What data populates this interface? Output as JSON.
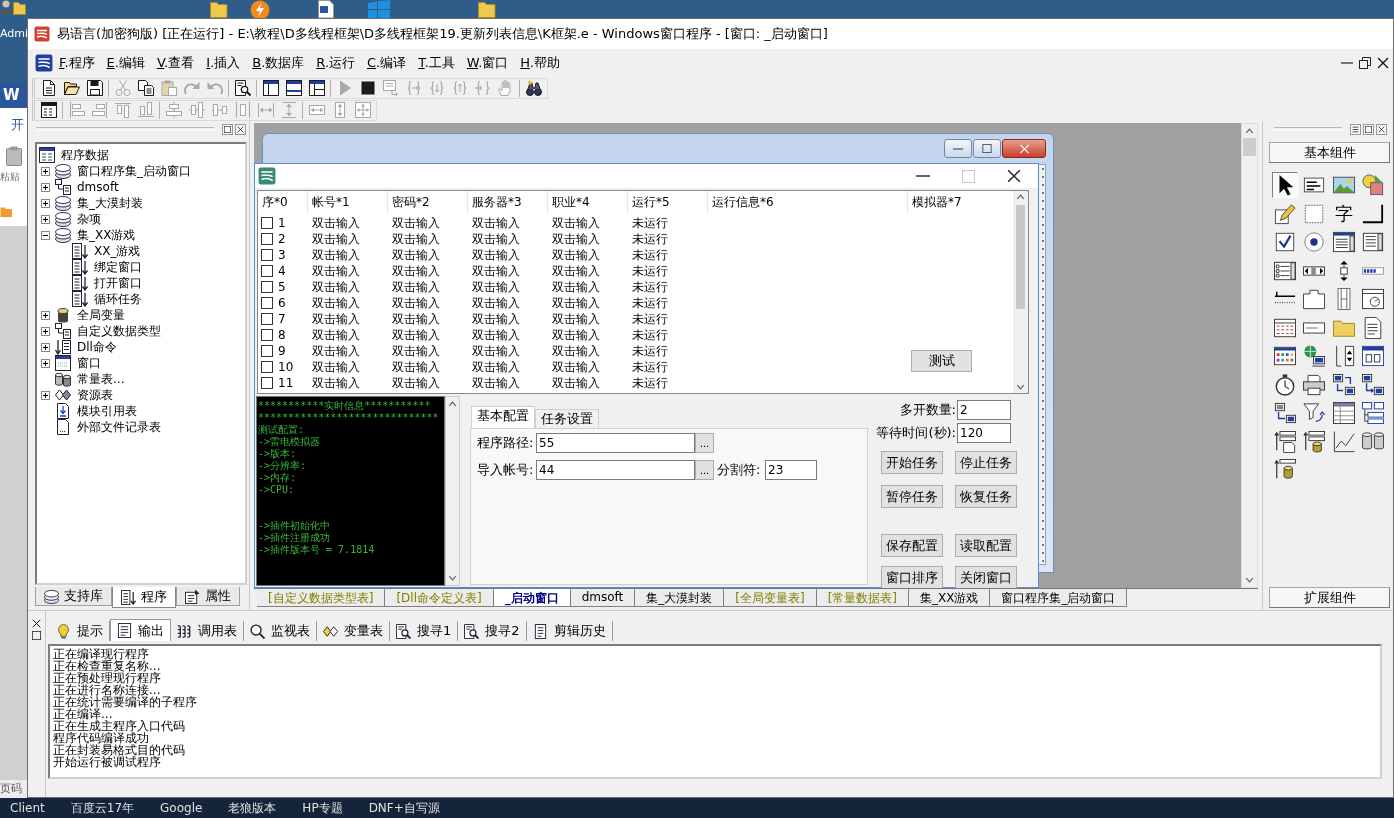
{
  "desktop": {
    "user_label": "Admi"
  },
  "side_window": {
    "logo": "W",
    "ribbon_tab": "开",
    "paste_label": "粘贴",
    "status": "页码"
  },
  "window": {
    "title": "易语言(加密狗版) [正在运行] - E:\\教程\\D多线程框架\\D多线程框架19.更新列表信息\\K框架.e - Windows窗口程序 - [窗口: _启动窗口]"
  },
  "menu": [
    {
      "mnemonic": "F",
      "label": ".程序"
    },
    {
      "mnemonic": "E",
      "label": ".编辑"
    },
    {
      "mnemonic": "V",
      "label": ".查看"
    },
    {
      "mnemonic": "I",
      "label": ".插入"
    },
    {
      "mnemonic": "B",
      "label": ".数据库"
    },
    {
      "mnemonic": "R",
      "label": ".运行"
    },
    {
      "mnemonic": "C",
      "label": ".编译"
    },
    {
      "mnemonic": "T",
      "label": ".工具"
    },
    {
      "mnemonic": "W",
      "label": ".窗口"
    },
    {
      "mnemonic": "H",
      "label": ".帮助"
    }
  ],
  "toolbar_1": [
    [
      {
        "disabled": false
      },
      {
        "disabled": false
      },
      {
        "disabled": false
      }
    ],
    [
      {
        "disabled": true
      },
      {
        "disabled": false
      },
      {
        "disabled": true
      },
      {
        "disabled": true
      },
      {
        "disabled": true
      }
    ],
    [
      {
        "disabled": false
      }
    ],
    [
      {
        "disabled": false
      },
      {
        "disabled": false
      },
      {
        "disabled": false
      }
    ],
    [
      {
        "disabled": true
      },
      {
        "disabled": false
      },
      {
        "disabled": true
      },
      {
        "disabled": true
      },
      {
        "disabled": true
      },
      {
        "disabled": true
      },
      {
        "disabled": true
      },
      {
        "disabled": true
      }
    ],
    [
      {
        "disabled": false
      }
    ]
  ],
  "toolbar_2": [
    [
      {
        "disabled": false
      }
    ],
    [
      {
        "disabled": true
      },
      {
        "disabled": true
      },
      {
        "disabled": true
      },
      {
        "disabled": true
      }
    ],
    [
      {
        "disabled": true
      },
      {
        "disabled": true
      },
      {
        "disabled": true
      },
      {
        "disabled": true
      },
      {
        "disabled": true
      },
      {
        "disabled": true
      }
    ],
    [
      {
        "disabled": true
      },
      {
        "disabled": true
      },
      {
        "disabled": true
      }
    ]
  ],
  "left_panel": {
    "tree": {
      "label": "程序数据",
      "kind": "root",
      "children": [
        {
          "label": "窗口程序集_启动窗口",
          "kind": "module",
          "expanded": false
        },
        {
          "label": "dmsoft",
          "kind": "class",
          "expanded": false
        },
        {
          "label": "集_大漠封装",
          "kind": "module",
          "expanded": false
        },
        {
          "label": "杂项",
          "kind": "module",
          "expanded": false
        },
        {
          "label": "集_XX游戏",
          "kind": "module",
          "expanded": true,
          "children": [
            {
              "label": "XX_游戏",
              "kind": "sub"
            },
            {
              "label": "绑定窗口",
              "kind": "sub"
            },
            {
              "label": "打开窗口",
              "kind": "sub"
            },
            {
              "label": "循环任务",
              "kind": "sub"
            }
          ]
        },
        {
          "label": "全局变量",
          "kind": "global",
          "expanded": false
        },
        {
          "label": "自定义数据类型",
          "kind": "class",
          "expanded": false
        },
        {
          "label": "Dll命令",
          "kind": "dll",
          "expanded": false
        },
        {
          "label": "窗口",
          "kind": "window",
          "expanded": false
        },
        {
          "label": "常量表...",
          "kind": "const"
        },
        {
          "label": "资源表",
          "kind": "resource",
          "expanded": false
        },
        {
          "label": "模块引用表",
          "kind": "modref"
        },
        {
          "label": "外部文件记录表",
          "kind": "file"
        }
      ]
    },
    "tabs": [
      {
        "label": "支持库",
        "selected": false
      },
      {
        "label": "程序",
        "selected": true
      },
      {
        "label": "属性",
        "selected": false
      }
    ]
  },
  "program_window": {
    "maximize": {
      "disabled": true
    },
    "columns": [
      "序*0",
      "帐号*1",
      "密码*2",
      "服务器*3",
      "职业*4",
      "运行*5",
      "运行信息*6",
      "模拟器*7"
    ],
    "rows": [
      {
        "checked": false,
        "cells": [
          "1",
          "双击输入",
          "双击输入",
          "双击输入",
          "双击输入",
          "未运行"
        ]
      },
      {
        "checked": false,
        "cells": [
          "2",
          "双击输入",
          "双击输入",
          "双击输入",
          "双击输入",
          "未运行"
        ]
      },
      {
        "checked": false,
        "cells": [
          "3",
          "双击输入",
          "双击输入",
          "双击输入",
          "双击输入",
          "未运行"
        ]
      },
      {
        "checked": false,
        "cells": [
          "4",
          "双击输入",
          "双击输入",
          "双击输入",
          "双击输入",
          "未运行"
        ]
      },
      {
        "checked": false,
        "cells": [
          "5",
          "双击输入",
          "双击输入",
          "双击输入",
          "双击输入",
          "未运行"
        ]
      },
      {
        "checked": false,
        "cells": [
          "6",
          "双击输入",
          "双击输入",
          "双击输入",
          "双击输入",
          "未运行"
        ]
      },
      {
        "checked": false,
        "cells": [
          "7",
          "双击输入",
          "双击输入",
          "双击输入",
          "双击输入",
          "未运行"
        ]
      },
      {
        "checked": false,
        "cells": [
          "8",
          "双击输入",
          "双击输入",
          "双击输入",
          "双击输入",
          "未运行"
        ]
      },
      {
        "checked": false,
        "cells": [
          "9",
          "双击输入",
          "双击输入",
          "双击输入",
          "双击输入",
          "未运行"
        ]
      },
      {
        "checked": false,
        "cells": [
          "10",
          "双击输入",
          "双击输入",
          "双击输入",
          "双击输入",
          "未运行"
        ]
      },
      {
        "checked": false,
        "cells": [
          "11",
          "双击输入",
          "双击输入",
          "双击输入",
          "双击输入",
          "未运行"
        ]
      }
    ],
    "test_button": "测试",
    "console": [
      [
        "***********实时信息***********",
        "******************************",
        "测试配置:",
        "->雷电模拟器",
        "->版本:",
        "->分辨率:",
        "->内存:",
        "->CPU:"
      ],
      [
        "->插件初始化中",
        "->插件注册成功",
        "->插件版本号 = 7.1814"
      ]
    ],
    "tabs": [
      {
        "label": "基本配置",
        "selected": true
      },
      {
        "label": "任务设置",
        "selected": false
      }
    ],
    "path_field": {
      "label": "程序路径:",
      "value": "55",
      "browse": "..."
    },
    "account_field": {
      "label": "导入帐号:",
      "value": "44",
      "browse": "..."
    },
    "separator_field": {
      "label": "分割符:",
      "value": "23"
    },
    "settings": [
      {
        "label": "多开数量:",
        "value": "2"
      },
      {
        "label": "等待时间(秒):",
        "value": "120"
      }
    ],
    "task_buttons": [
      "开始任务",
      "停止任务",
      "暂停任务",
      "恢复任务"
    ],
    "config_buttons": [
      "保存配置",
      "读取配置",
      "窗口排序",
      "关闭窗口"
    ]
  },
  "editor_tabs": [
    {
      "label": "[自定义数据类型表]",
      "selected": false,
      "kind": "table"
    },
    {
      "label": "[Dll命令定义表]",
      "selected": false,
      "kind": "table"
    },
    {
      "label": "_启动窗口",
      "selected": true,
      "kind": "code"
    },
    {
      "label": "dmsoft",
      "selected": false,
      "kind": "code"
    },
    {
      "label": "集_大漠封装",
      "selected": false,
      "kind": "code"
    },
    {
      "label": "[全局变量表]",
      "selected": false,
      "kind": "table"
    },
    {
      "label": "[常量数据表]",
      "selected": false,
      "kind": "table"
    },
    {
      "label": "集_XX游戏",
      "selected": false,
      "kind": "code"
    },
    {
      "label": "窗口程序集_启动窗口",
      "selected": false,
      "kind": "code"
    }
  ],
  "components_panel": {
    "header": "基本组件",
    "items": [
      {
        "selected": true
      },
      {
        "selected": false
      },
      {
        "selected": false
      },
      {
        "selected": false
      },
      {
        "selected": false
      },
      {
        "selected": false
      },
      {
        "selected": false,
        "glyph": "字"
      },
      {
        "selected": false
      },
      {
        "selected": false
      },
      {
        "selected": false
      },
      {
        "selected": false
      },
      {
        "selected": false
      },
      {
        "selected": false
      },
      {
        "selected": false
      },
      {
        "selected": false
      },
      {
        "selected": false
      },
      {
        "selected": false
      },
      {
        "selected": false
      },
      {
        "selected": false
      },
      {
        "selected": false
      },
      {
        "selected": false
      },
      {
        "selected": false
      },
      {
        "selected": false
      },
      {
        "selected": false
      },
      {
        "selected": false
      },
      {
        "selected": false
      },
      {
        "selected": false
      },
      {
        "selected": false
      },
      {
        "selected": false
      },
      {
        "selected": false
      },
      {
        "selected": false
      },
      {
        "selected": false
      },
      {
        "selected": false
      },
      {
        "selected": false
      },
      {
        "selected": false
      },
      {
        "selected": false
      },
      {
        "selected": false
      },
      {
        "selected": false
      },
      {
        "selected": false
      },
      {
        "selected": false
      },
      {
        "selected": false
      }
    ],
    "footer": "扩展组件"
  },
  "output_panel": {
    "tabs": [
      {
        "label": "提示",
        "selected": false
      },
      {
        "label": "输出",
        "selected": true
      },
      {
        "label": "调用表",
        "selected": false
      },
      {
        "label": "监视表",
        "selected": false
      },
      {
        "label": "变量表",
        "selected": false
      },
      {
        "label": "搜寻1",
        "selected": false
      },
      {
        "label": "搜寻2",
        "selected": false
      },
      {
        "label": "剪辑历史",
        "selected": false
      }
    ],
    "lines": [
      "正在编译现行程序",
      "正在检查重复名称...",
      "正在预处理现行程序",
      "正在进行名称连接...",
      "正在统计需要编译的子程序",
      "正在编译...",
      "正在生成主程序入口代码",
      "程序代码编译成功",
      "正在封装易格式目的代码",
      "开始运行被调试程序"
    ]
  },
  "taskbar": [
    "Client",
    "百度云17年",
    "Google",
    "老狼版本",
    "HP专题",
    "DNF+自写源"
  ]
}
